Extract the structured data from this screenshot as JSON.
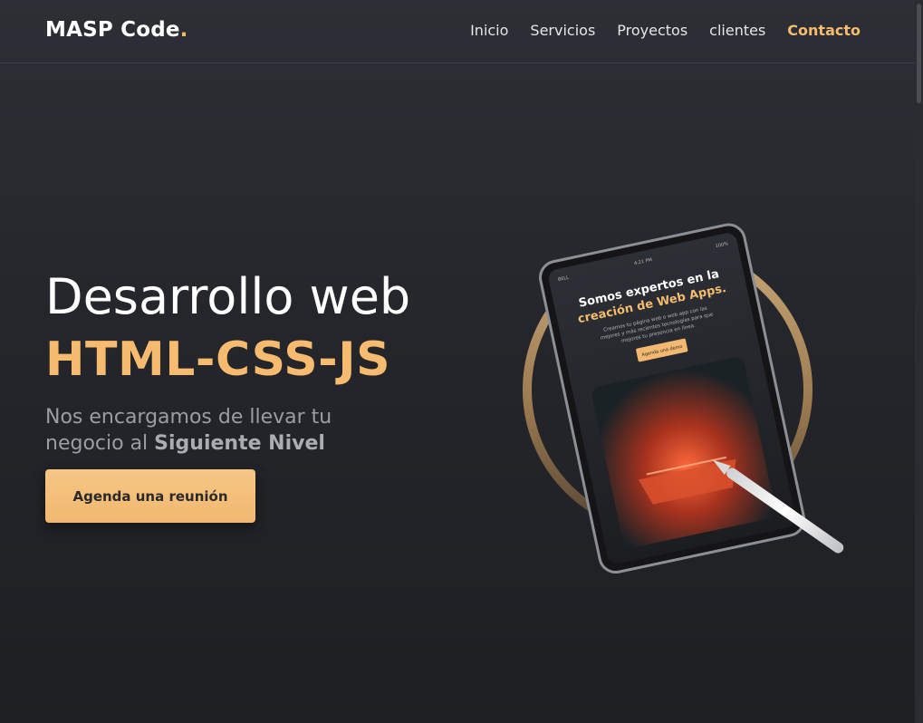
{
  "brand": {
    "name": "MASP Code",
    "dot": ".",
    "accent": "#f6bb6e"
  },
  "nav": {
    "items": [
      {
        "label": "Inicio",
        "active": false
      },
      {
        "label": "Servicios",
        "active": false
      },
      {
        "label": "Proyectos",
        "active": false
      },
      {
        "label": "clientes",
        "active": false
      },
      {
        "label": "Contacto",
        "active": true
      }
    ]
  },
  "hero": {
    "title": "Desarrollo web",
    "subtitle": "HTML-CSS-JS",
    "desc_line1": "Nos encargamos de llevar tu",
    "desc_line2_prefix": "negocio al ",
    "desc_emphasis": "Siguiente Nivel",
    "cta_label": "Agenda una reunión"
  },
  "tablet": {
    "status_left": "BELL",
    "status_time": "4:21 PM",
    "status_battery": "100%",
    "headline_line1": "Somos expertos en la",
    "headline_line2": "creación de Web Apps.",
    "body_line1": "Creamos tu página web o web app con las",
    "body_line2": "mejores y más recientes tecnologías para que",
    "body_line3": "mejores tu presencia en línea.",
    "button_label": "Agenda una demo"
  }
}
